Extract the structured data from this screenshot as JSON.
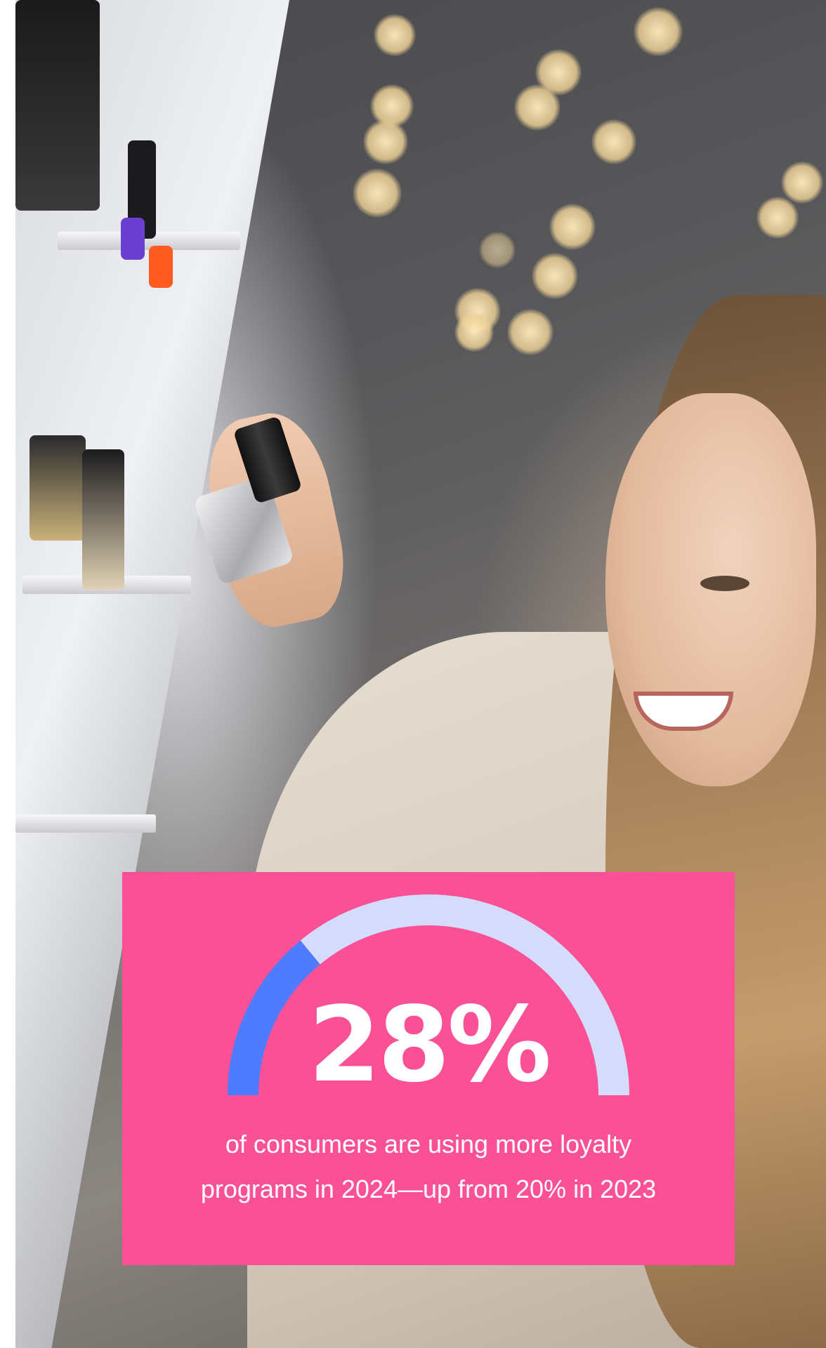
{
  "stat": {
    "value": "28%",
    "caption_line1": "of consumers are using more loyalty",
    "caption_line2": "programs in 2024—up from 20% in 2023",
    "gauge_fraction": 0.28
  },
  "colors": {
    "card_background": "#fa5096",
    "gauge_fill": "#4f7cff",
    "gauge_track": "#d5dcfb",
    "text": "#ffffff"
  }
}
